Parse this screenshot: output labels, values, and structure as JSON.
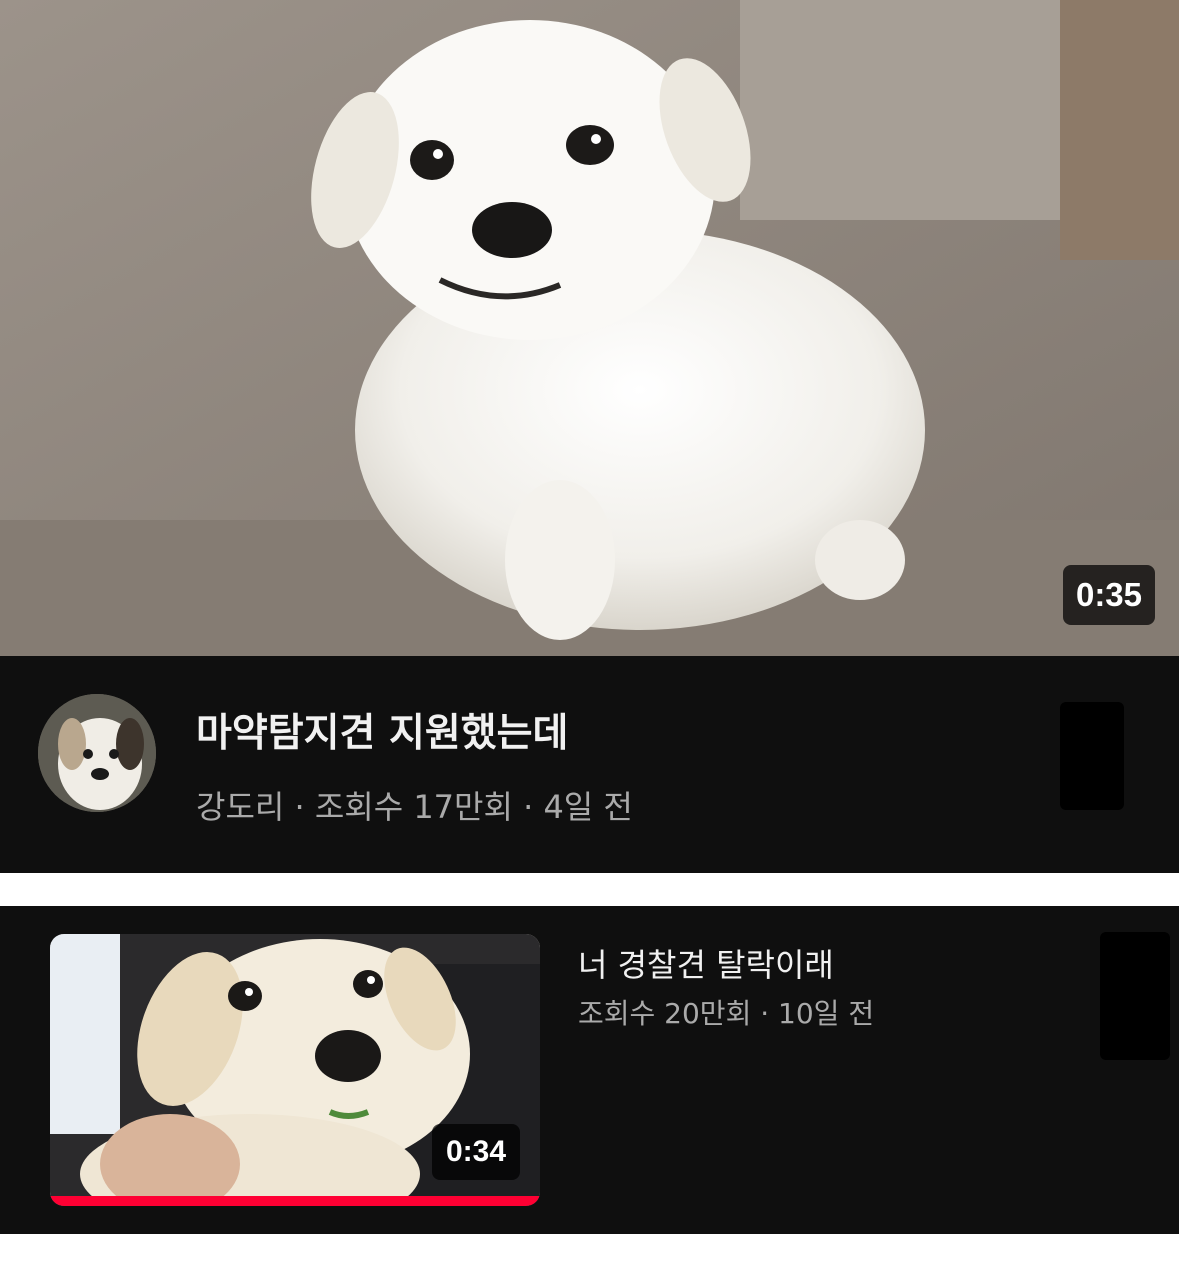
{
  "video1": {
    "duration": "0:35",
    "title": "마약탐지견 지원했는데",
    "meta": "강도리 · 조회수 17만회 · 4일 전"
  },
  "video2": {
    "duration": "0:34",
    "title": "너 경찰견 탈락이래",
    "meta": "조회수 20만회 · 10일 전",
    "watched_progress": 1.0
  },
  "colors": {
    "card_background": "#0f0f0f",
    "title_text": "#f1f1f1",
    "meta_text": "#aaaaaa",
    "progress_bar": "#ff0033"
  }
}
